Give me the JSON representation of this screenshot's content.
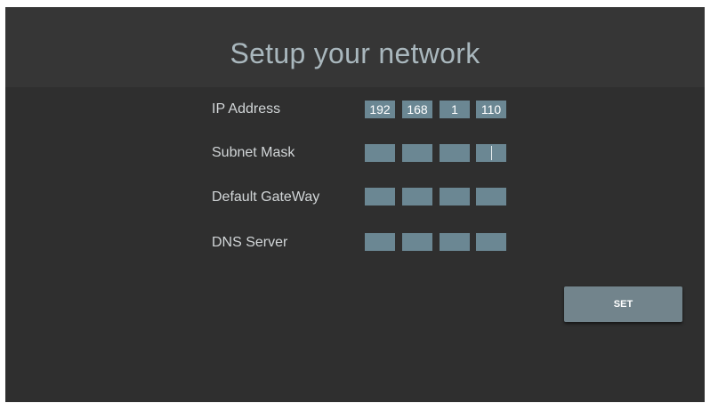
{
  "page": {
    "title": "Setup your network",
    "colors": {
      "background": "#2f2f2f",
      "title_band": "#363636",
      "title_text": "#a9b7bd",
      "field_fill": "#6b8793",
      "button_fill": "#72848c"
    }
  },
  "form": {
    "rows": [
      {
        "label": "IP Address",
        "octets": [
          "192",
          "168",
          "1",
          "110"
        ]
      },
      {
        "label": "Subnet Mask",
        "octets": [
          "",
          "",
          "",
          ""
        ],
        "focused_octet": 4
      },
      {
        "label": "Default GateWay",
        "octets": [
          "",
          "",
          "",
          ""
        ]
      },
      {
        "label": "DNS Server",
        "octets": [
          "",
          "",
          "",
          ""
        ]
      }
    ]
  },
  "actions": {
    "set_label": "SET"
  }
}
